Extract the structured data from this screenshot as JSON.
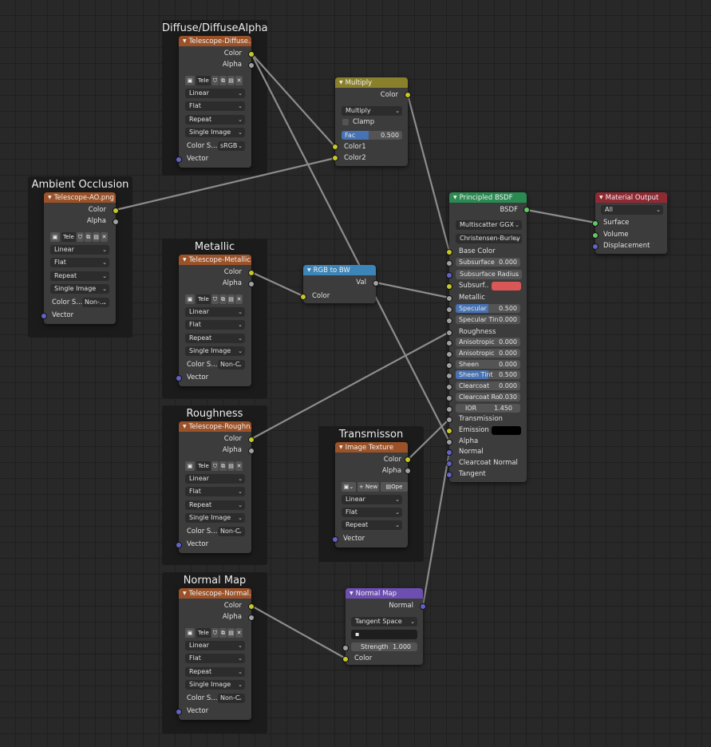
{
  "frames": {
    "diffuse": "Diffuse/DiffuseAlpha",
    "ao": "Ambient Occlusion",
    "metallic": "Metallic",
    "roughness": "Roughness",
    "transmission": "Transmisson",
    "normal": "Normal Map"
  },
  "image_nodes": {
    "diffuse": {
      "title": "Telescope-Diffuse...",
      "image": "Tele",
      "color_space_label": "Color S...",
      "color_space": "sRGB"
    },
    "ao": {
      "title": "Telescope-AO.png",
      "image": "Tele",
      "color_space_label": "Color S...",
      "color_space": "Non-..."
    },
    "metallic": {
      "title": "Telescope-Metallic...",
      "image": "Tele",
      "color_space_label": "Color S...",
      "color_space": "Non-C"
    },
    "roughness": {
      "title": "Telescope-Roughn...",
      "image": "Tele",
      "color_space_label": "Color S...",
      "color_space": "Non-C"
    },
    "normal": {
      "title": "Telescope-Normal...",
      "image": "Tele",
      "color_space_label": "Color S...",
      "color_space": "Non-C"
    }
  },
  "image_common": {
    "out_color": "Color",
    "out_alpha": "Alpha",
    "interpolation": "Linear",
    "projection": "Flat",
    "extension": "Repeat",
    "source": "Single Image",
    "in_vector": "Vector"
  },
  "transmission_node": {
    "title": "Image Texture",
    "out_color": "Color",
    "out_alpha": "Alpha",
    "new_label": "+ New",
    "open_label": "Ope",
    "interpolation": "Linear",
    "projection": "Flat",
    "extension": "Repeat",
    "in_vector": "Vector"
  },
  "multiply_node": {
    "title": "Multiply",
    "out_color": "Color",
    "blend_type": "Multiply",
    "clamp": "Clamp",
    "fac_label": "Fac",
    "fac": "0.500",
    "in_color1": "Color1",
    "in_color2": "Color2"
  },
  "rgb_to_bw": {
    "title": "RGB to BW",
    "out_val": "Val",
    "in_color": "Color"
  },
  "principled": {
    "title": "Principled BSDF",
    "out_bsdf": "BSDF",
    "distribution": "Multiscatter GGX",
    "subsurface_method": "Christensen-Burley",
    "base_color": "Base Color",
    "subsurface": {
      "label": "Subsurface",
      "value": "0.000"
    },
    "subsurface_radius": "Subsurface Radius",
    "subsurface_color": "Subsurf..",
    "subsurface_color_hex": "#d95757",
    "metallic": "Metallic",
    "specular": {
      "label": "Specular",
      "value": "0.500"
    },
    "specular_tint": {
      "label": "Specular Tin",
      "value": "0.000"
    },
    "roughness": "Roughness",
    "anisotropic": {
      "label": "Anisotropic",
      "value": "0.000"
    },
    "anisotropic_rotation": {
      "label": "Anisotropic",
      "value": "0.000"
    },
    "sheen": {
      "label": "Sheen",
      "value": "0.000"
    },
    "sheen_tint": {
      "label": "Sheen Tint",
      "value": "0.500"
    },
    "clearcoat": {
      "label": "Clearcoat",
      "value": "0.000"
    },
    "clearcoat_roughness": {
      "label": "Clearcoat Ro",
      "value": "0.030"
    },
    "ior": {
      "label": "IOR",
      "value": "1.450"
    },
    "transmission": "Transmission",
    "emission": "Emission",
    "emission_hex": "#000000",
    "alpha": "Alpha",
    "normal": "Normal",
    "clearcoat_normal": "Clearcoat Normal",
    "tangent": "Tangent"
  },
  "material_output": {
    "title": "Material Output",
    "target": "All",
    "surface": "Surface",
    "volume": "Volume",
    "displacement": "Displacement"
  },
  "normal_map_node": {
    "title": "Normal Map",
    "out_normal": "Normal",
    "space": "Tangent Space",
    "uv_field": "",
    "strength_label": "Strength",
    "strength": "1.000",
    "in_color": "Color"
  },
  "colors": {
    "background": "#282828",
    "texture_header": "#9b5228",
    "color_header": "#8a7f2a",
    "converter_header": "#3c85b8",
    "shader_header": "#2a8a52",
    "output_header": "#8f2a33",
    "vector_header": "#6c4fb1",
    "link": "#8c8c8c"
  }
}
